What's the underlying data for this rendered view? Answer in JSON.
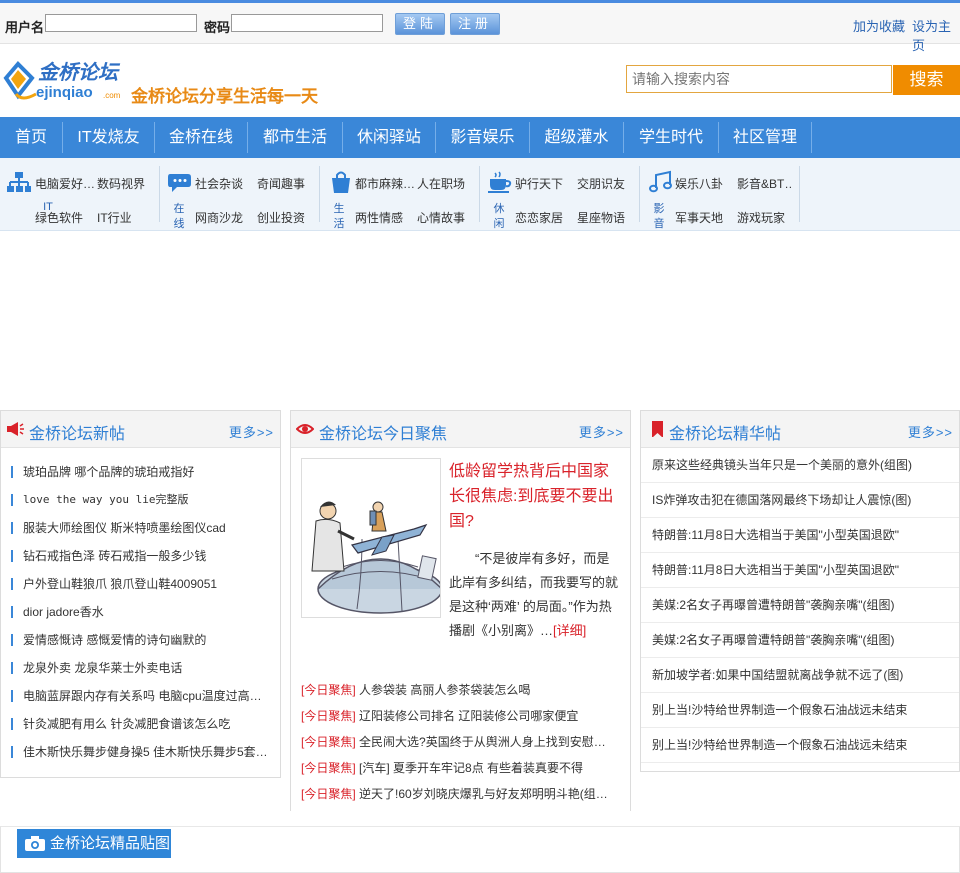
{
  "topbar": {
    "username_label": "用户名",
    "password_label": "密码",
    "login_button": "登陆",
    "register_button": "注册",
    "bookmark_link": "加为收藏",
    "homepage_link": "设为主页"
  },
  "header": {
    "logo_text": "金桥论坛",
    "logo_domain": "ejinqiao",
    "logo_tld": ".com",
    "slogan": "金桥论坛分享生活每一天",
    "search_placeholder": "请输入搜索内容",
    "search_button": "搜索"
  },
  "nav": {
    "items": [
      "首页",
      "IT发烧友",
      "金桥在线",
      "都市生活",
      "休闲驿站",
      "影音娱乐",
      "超级灌水",
      "学生时代",
      "社区管理"
    ]
  },
  "subnav": {
    "groups": [
      {
        "icon": "network-icon",
        "category": "IT",
        "links": [
          "电脑爱好…",
          "数码视界",
          "绿色软件",
          "IT行业"
        ]
      },
      {
        "icon": "chat-bubble-icon",
        "category": "在线",
        "links": [
          "社会杂谈",
          "奇闻趣事",
          "网商沙龙",
          "创业投资"
        ]
      },
      {
        "icon": "shopping-bag-icon",
        "category": "生活",
        "links": [
          "都市麻辣…",
          "人在职场",
          "两性情感",
          "心情故事"
        ]
      },
      {
        "icon": "coffee-cup-icon",
        "category": "休闲",
        "links": [
          "驴行天下",
          "交朋识友",
          "恋恋家居",
          "星座物语"
        ]
      },
      {
        "icon": "music-note-icon",
        "category": "影音",
        "links": [
          "娱乐八卦",
          "影音&BT…",
          "军事天地",
          "游戏玩家"
        ]
      }
    ]
  },
  "new_posts": {
    "title": "金桥论坛新帖",
    "more": "更多>>",
    "items": [
      "琥珀品牌 哪个品牌的琥珀戒指好",
      "love the way you lie完整版",
      "服装大师绘图仪 斯米特喷墨绘图仪cad",
      "钻石戒指色泽 砖石戒指一般多少钱",
      "户外登山鞋狼爪 狼爪登山鞋4009051",
      "dior jadore香水",
      "爱情感慨诗 感慨爱情的诗句幽默的",
      "龙泉外卖 龙泉华莱士外卖电话",
      "电脑蓝屏跟内存有关系吗 电脑cpu温度过高…",
      "针灸减肥有用么 针灸减肥食谱该怎么吃",
      "佳木斯快乐舞步健身操5 佳木斯快乐舞步5套…"
    ]
  },
  "focus": {
    "title": "金桥论坛今日聚焦",
    "more": "更多>>",
    "headline": "低龄留学热背后中国家长很焦虑:到底要不要出国?",
    "summary": "“不是彼岸有多好，而是此岸有多纠结，而我要写的就是这种‘两难’ 的局面。”作为热播剧《小别离》…",
    "detail_link": "[详细]",
    "items": [
      {
        "tag": "[今日聚焦]",
        "text": "人参袋装 高丽人参茶袋装怎么喝"
      },
      {
        "tag": "[今日聚焦]",
        "text": "辽阳装修公司排名 辽阳装修公司哪家便宜"
      },
      {
        "tag": "[今日聚焦]",
        "text": "全民闹大选?英国终于从舆洲人身上找到安慰…"
      },
      {
        "tag": "[今日聚焦]",
        "text": "[汽车] 夏季开车牢记8点 有些着装真要不得"
      },
      {
        "tag": "[今日聚焦]",
        "text": "逆天了!60岁刘晓庆爆乳与好友郑明明斗艳(组…"
      }
    ]
  },
  "best": {
    "title": "金桥论坛精华帖",
    "more": "更多>>",
    "items": [
      "原来这些经典镜头当年只是一个美丽的意外(组图)",
      "IS炸弹攻击犯在德国落网最终下场却让人震惊(图)",
      "特朗普:11月8日大选相当于美国\"小型英国退欧\"",
      "特朗普:11月8日大选相当于美国\"小型英国退欧\"",
      "美媒:2名女子再曝曾遭特朗普\"袭胸亲嘴\"(组图)",
      "美媒:2名女子再曝曾遭特朗普\"袭胸亲嘴\"(组图)",
      "新加坡学者:如果中国结盟就离战争就不远了(图)",
      "别上当!沙特给世界制造一个假象石油战远未结束",
      "别上当!沙特给世界制造一个假象石油战远未结束"
    ]
  },
  "pictures": {
    "title": "金桥论坛精品贴图"
  },
  "colors": {
    "nav_blue": "#3a87d8",
    "accent_orange": "#f08c00",
    "headline_red": "#d9222a",
    "link_blue": "#2f7fd4"
  }
}
